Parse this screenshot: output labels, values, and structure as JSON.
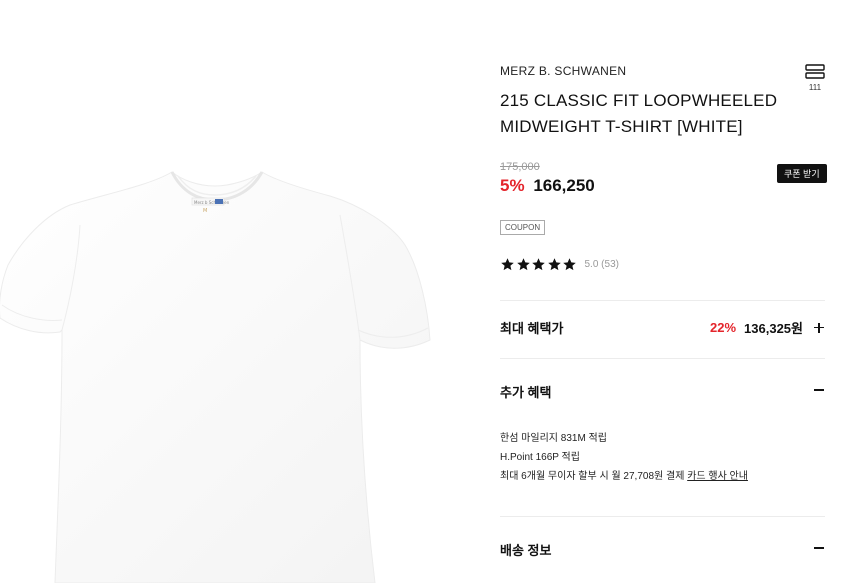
{
  "product": {
    "brand": "MERZ B. SCHWANEN",
    "title": "215 CLASSIC FIT LOOPWHEELED MIDWEIGHT T-SHIRT [WHITE]",
    "like_count": "111",
    "original_price": "175,000",
    "discount": "5%",
    "sale_price": "166,250",
    "coupon_button_label": "쿠폰 받기",
    "coupon_tag": "COUPON",
    "rating": 5,
    "rating_text": "5.0 (53)",
    "star_color": "#111111"
  },
  "max_benefit": {
    "label": "최대 혜택가",
    "discount": "22%",
    "price": "136,325원"
  },
  "extra_benefit": {
    "label": "추가 혜택",
    "lines": [
      "한섬 마일리지 831M 적립",
      "H.Point 166P 적립"
    ],
    "installment_text": "최대 6개월 무이자 할부 시 월 27,708원 결제",
    "card_link": "카드 행사 안내"
  },
  "shipping": {
    "label": "배송 정보"
  },
  "colors": {
    "accent_red": "#e4252c",
    "black": "#111111"
  }
}
